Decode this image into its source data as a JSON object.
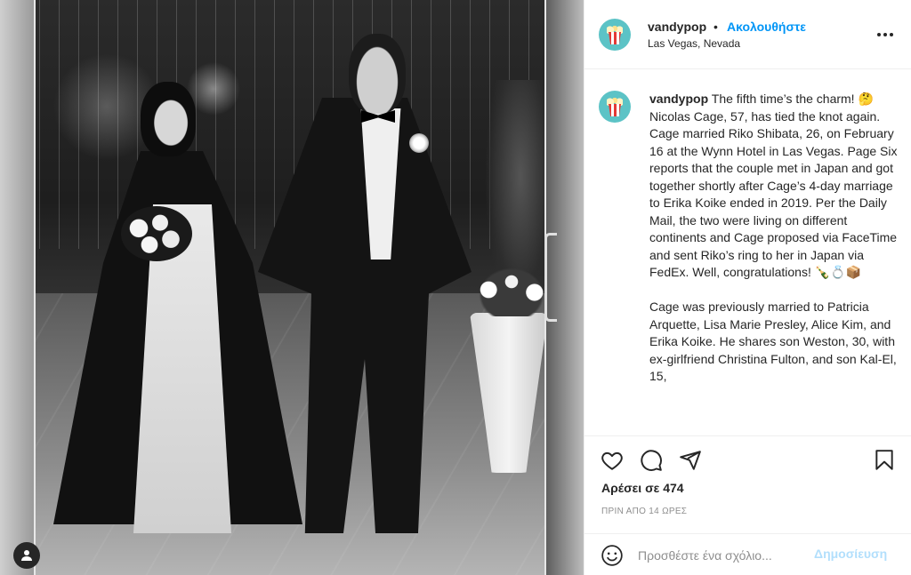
{
  "post": {
    "username": "vandypop",
    "follow_label": "Ακολουθήστε",
    "separator": "•",
    "location": "Las Vegas, Nevada",
    "caption_paragraph_1": "The fifth time’s the charm! 🤔Nicolas Cage, 57, has tied the knot again. Cage married Riko Shibata, 26, on February 16 at the Wynn Hotel in Las Vegas. Page Six reports that the couple met in Japan and got together shortly after Cage’s 4-day marriage to Erika Koike ended in 2019. Per the Daily Mail, the two were living on different continents and Cage proposed via FaceTime and sent Riko’s ring to her in Japan via FedEx. Well, congratulations! 🍾💍📦",
    "caption_paragraph_2": "Cage was previously married to Patricia Arquette, Lisa Marie Presley, Alice Kim, and Erika Koike. He shares son Weston, 30, with ex-girlfriend Christina Fulton, and son Kal-El, 15,",
    "likes_text": "Αρέσει σε 474",
    "timestamp": "ΠΡΙΝ ΑΠΟ 14 ΩΡΕΣ"
  },
  "comment_box": {
    "placeholder": "Προσθέστε ένα σχόλιο...",
    "publish_label": "Δημοσίευση"
  },
  "icons": {
    "more": "more-options-icon",
    "like": "heart-icon",
    "comment": "comment-bubble-icon",
    "share": "paper-plane-icon",
    "save": "bookmark-icon",
    "emoji": "smiley-icon",
    "tag": "user-tag-icon"
  },
  "colors": {
    "accent": "#0095f6",
    "publish_disabled": "#b2dffc",
    "avatar_bg": "#5cc3c6",
    "muted": "#8e8e8e"
  }
}
